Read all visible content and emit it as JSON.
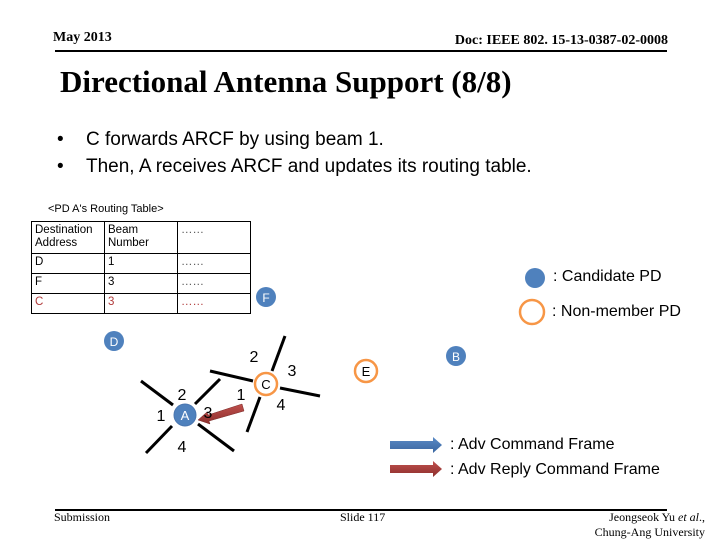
{
  "header": {
    "date": "May 2013",
    "doc_id": "Doc: IEEE 802. 15-13-0387-02-0008"
  },
  "slide": {
    "title": "Directional Antenna Support (8/8)",
    "bullets": [
      "C forwards ARCF by using beam 1.",
      "Then, A receives ARCF and updates its routing table."
    ],
    "bullet_glyph": "•"
  },
  "routing_table": {
    "caption": "<PD A's Routing Table>",
    "headers": [
      "Destination Address",
      "Beam Number",
      "……"
    ],
    "rows": [
      {
        "dest": "D",
        "beam": "1",
        "more": "……",
        "highlight": false
      },
      {
        "dest": "F",
        "beam": "3",
        "more": "……",
        "highlight": false
      },
      {
        "dest": "C",
        "beam": "3",
        "more": "……",
        "highlight": true
      }
    ]
  },
  "diagram": {
    "nodes": [
      {
        "id": "A",
        "label": "A",
        "type": "candidate"
      },
      {
        "id": "B",
        "label": "B",
        "type": "candidate"
      },
      {
        "id": "C",
        "label": "C",
        "type": "non-member"
      },
      {
        "id": "D",
        "label": "D",
        "type": "candidate"
      },
      {
        "id": "E",
        "label": "E",
        "type": "non-member"
      },
      {
        "id": "F",
        "label": "F",
        "type": "candidate"
      }
    ],
    "beam_labels_A": [
      "1",
      "2",
      "3",
      "4"
    ],
    "beam_labels_C": [
      "1",
      "2",
      "3",
      "4"
    ],
    "arrow": {
      "from": "C",
      "to": "A",
      "kind": "reply"
    }
  },
  "legend": {
    "candidate": ": Candidate PD",
    "non_member": ": Non-member PD",
    "adv_command": ": Adv Command Frame",
    "adv_reply": ": Adv Reply Command Frame"
  },
  "colors": {
    "candidate_fill": "#4f81bd",
    "non_member_stroke": "#f79646",
    "reply_arrow": "#a33a3a",
    "command_arrow": "#4a76b0",
    "highlight_text": "#b03a3a"
  },
  "footer": {
    "left": "Submission",
    "center": "Slide 117",
    "author_name": "Jeongseok Yu ",
    "author_etal": "et al",
    "author_suffix": ".,",
    "affiliation": "Chung-Ang University"
  }
}
